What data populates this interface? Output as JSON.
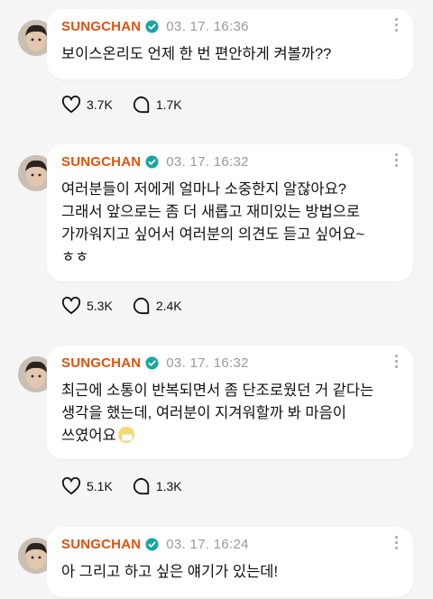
{
  "posts": [
    {
      "author": "SUNGCHAN",
      "time": "03. 17. 16:36",
      "text": "보이스온리도 언제 한 번 편안하게 켜볼까??",
      "likes": "3.7K",
      "comments": "1.7K"
    },
    {
      "author": "SUNGCHAN",
      "time": "03. 17. 16:32",
      "text": "여러분들이 저에게 얼마나 소중한지 알잖아요?\n그래서 앞으로는 좀 더 새롭고 재미있는 방법으로\n가까워지고 싶어서 여러분의 의견도 듣고 싶어요~\nㅎㅎ",
      "likes": "5.3K",
      "comments": "2.4K"
    },
    {
      "author": "SUNGCHAN",
      "time": "03. 17. 16:32",
      "text": "최근에 소통이 반복되면서 좀 단조로웠던 거 같다는\n생각을 했는데, 여러분이 지겨워할까 봐 마음이\n쓰였어요",
      "emoji_icon": "face-with-medical-mask",
      "likes": "5.1K",
      "comments": "1.3K"
    },
    {
      "author": "SUNGCHAN",
      "time": "03. 17. 16:24",
      "text": "아 그리고 하고 싶은 얘기가 있는데!"
    }
  ],
  "colors": {
    "accent": "#e2520e",
    "badge": "#1aa6a0",
    "background": "#f5f5f5"
  }
}
